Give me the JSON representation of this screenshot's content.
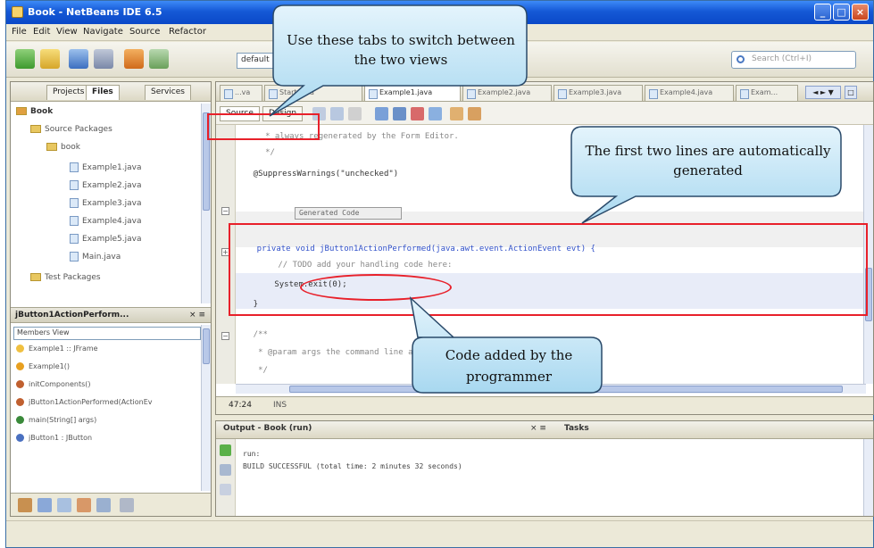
{
  "window": {
    "title": "Book - NetBeans IDE 6.5",
    "buttons": {
      "minimize": "_",
      "maximize": "□",
      "close": "×"
    }
  },
  "menu": [
    "File",
    "Edit",
    "View",
    "Navigate",
    "Source",
    "Refactor"
  ],
  "toolbar": {
    "config_value": "default",
    "search_placeholder": "Search (Ctrl+I)"
  },
  "left_panel": {
    "tabs": [
      "Projects",
      "Files",
      "Services"
    ],
    "tree": [
      {
        "label": "Book",
        "type": "project"
      },
      {
        "label": "Source Packages",
        "type": "folder"
      },
      {
        "label": "book",
        "type": "package"
      },
      {
        "label": "Example1.java",
        "type": "file"
      },
      {
        "label": "Example2.java",
        "type": "file"
      },
      {
        "label": "Example3.java",
        "type": "file"
      },
      {
        "label": "Example4.java",
        "type": "file"
      },
      {
        "label": "Example5.java",
        "type": "file"
      },
      {
        "label": "Main.java",
        "type": "file"
      },
      {
        "label": "Test Packages",
        "type": "folder"
      }
    ],
    "navigator_title": "jButton1ActionPerform...",
    "navigator_close": "× ≡",
    "navigator_view": "Members View",
    "members": [
      {
        "label": "Example1 :: JFrame",
        "color": "#f0c040"
      },
      {
        "label": "Example1()",
        "color": "#e8a020"
      },
      {
        "label": "initComponents()",
        "color": "#c06030"
      },
      {
        "label": "jButton1ActionPerformed(ActionEv",
        "color": "#c06030"
      },
      {
        "label": "main(String[] args)",
        "color": "#3a8a3a"
      },
      {
        "label": "jButton1 : JButton",
        "color": "#4a70c0"
      }
    ]
  },
  "editor": {
    "tabs": [
      "...va",
      "Start.java",
      "Example1.java",
      "Example2.java",
      "Example3.java",
      "Example4.java",
      "Exam..."
    ],
    "tab_nav": [
      "◄ ► ▼",
      "□"
    ],
    "view_buttons": [
      "Source",
      "Design"
    ],
    "code_lines": [
      "     * always regenerated by the Form Editor.",
      "     */",
      "    @SuppressWarnings(\"unchecked\")",
      "Generated Code",
      "    private void jButton1ActionPerformed(java.awt.event.ActionEvent evt) {",
      "        // TODO add your handling code here:",
      "        System.exit(0);",
      "    }",
      "    /**",
      "     * @param args the command line arguments",
      "     */"
    ],
    "status_position": "47:24",
    "status_mode": "INS"
  },
  "output": {
    "title": "Output - Book (run)",
    "controls": "× ≡",
    "tasks_tab": "Tasks",
    "lines": [
      "run:",
      "BUILD SUCCESSFUL (total time: 2 minutes 32 seconds)"
    ]
  },
  "annotations": {
    "tabs_callout": "Use these tabs to switch between the two views",
    "generated_callout": "The first two lines are automatically generated",
    "added_callout": "Code added by the programmer"
  }
}
